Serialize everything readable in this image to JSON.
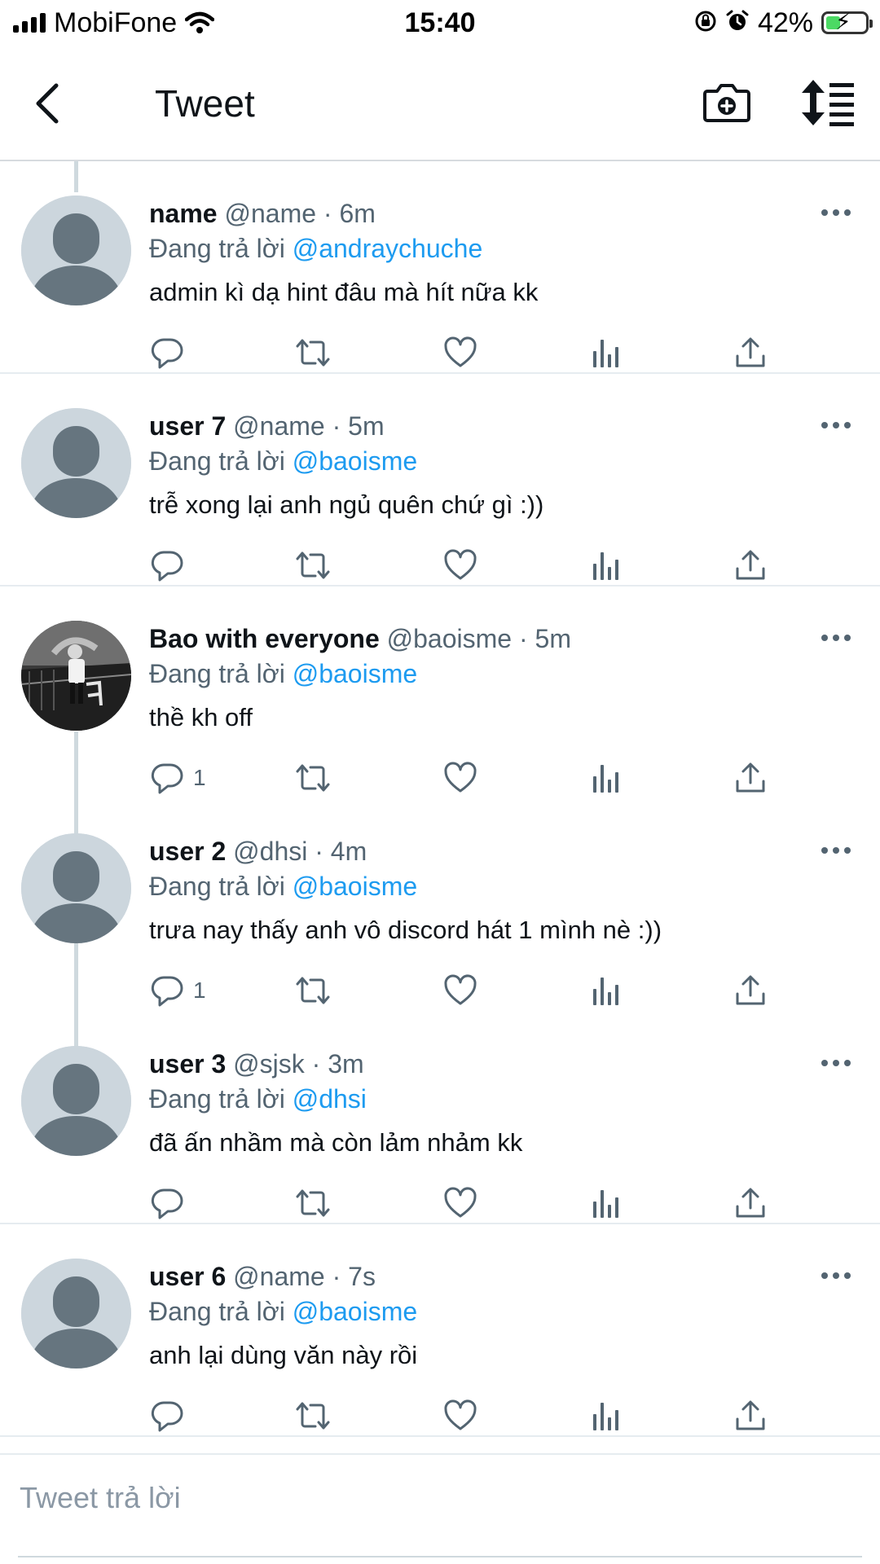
{
  "status_bar": {
    "carrier": "MobiFone",
    "time": "15:40",
    "battery": "42%",
    "battery_level": 0.42
  },
  "header": {
    "title": "Tweet",
    "icons": [
      "back-arrow-icon",
      "camera-plus-icon",
      "sort-icon"
    ]
  },
  "reply_label": "Đang trả lời",
  "tweets": [
    {
      "display_name": "name",
      "meta": "@name · 6m",
      "reply_to": "@andraychuche",
      "text": "admin kì dạ hint đâu mà hít nữa kk",
      "reply_count": "",
      "avatar": "default"
    },
    {
      "display_name": "user 7",
      "meta": "@name · 5m",
      "reply_to": "@baoisme",
      "text": "trễ xong lại anh ngủ quên chứ gì :))",
      "reply_count": "",
      "avatar": "default"
    },
    {
      "display_name": "Bao with everyone",
      "meta": "@baoisme · 5m",
      "reply_to": "@baoisme",
      "text": "thề kh off",
      "reply_count": "1",
      "avatar": "photo"
    },
    {
      "display_name": "user 2",
      "meta": " @dhsi · 4m",
      "reply_to": "@baoisme",
      "text": "trưa nay thấy anh vô discord hát 1 mình nè :))",
      "reply_count": "1",
      "avatar": "default"
    },
    {
      "display_name": "user 3",
      "meta": "@sjsk · 3m",
      "reply_to": "@dhsi",
      "text": "đã ấn nhầm mà còn lảm nhảm kk",
      "reply_count": "",
      "avatar": "default"
    },
    {
      "display_name": "user 6",
      "meta": "@name · 7s",
      "reply_to": "@baoisme",
      "text": "anh lại dùng văn này rồi",
      "reply_count": "",
      "avatar": "default"
    }
  ],
  "compose": {
    "placeholder": "Tweet trả lời"
  },
  "colors": {
    "link": "#1d9bf0",
    "muted": "#536471",
    "text": "#0f1419",
    "avatar_bg": "#ccd6dd",
    "avatar_fg": "#66757f",
    "battery_fill": "#4cd964"
  }
}
